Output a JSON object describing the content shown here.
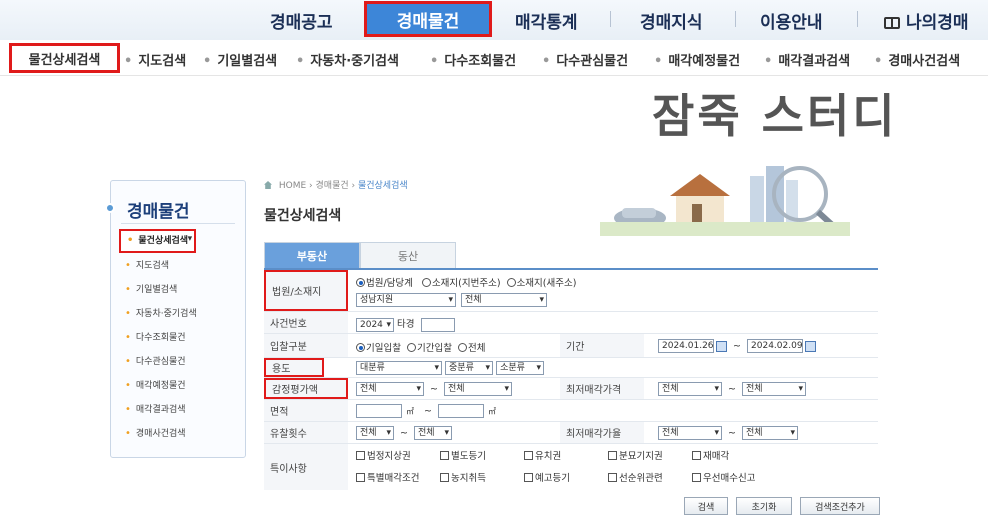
{
  "topnav": {
    "items": [
      "경매공고",
      "경매물건",
      "매각통계",
      "경매지식",
      "이용안내",
      "나의경매"
    ],
    "active": "경매물건"
  },
  "subnav": {
    "items": [
      "물건상세검색",
      "지도검색",
      "기일별검색",
      "자동차·중기검색",
      "다수조회물건",
      "다수관심물건",
      "매각예정물건",
      "매각결과검색",
      "경매사건검색"
    ]
  },
  "overlay_title": "잠죽 스터디",
  "sidebar": {
    "title": "경매물건",
    "items": [
      "물건상세검색",
      "지도검색",
      "기일별검색",
      "자동차·중기검색",
      "다수조회물건",
      "다수관심물건",
      "매각예정물건",
      "매각결과검색",
      "경매사건검색"
    ]
  },
  "breadcrumb": [
    "HOME",
    "경매물건",
    "물건상세검색"
  ],
  "page_title": "물건상세검색",
  "tabs": [
    "부동산",
    "동산"
  ],
  "form": {
    "court": {
      "label": "법원/소재지",
      "radio_options": [
        "법원/담당계",
        "소재지(지번주소)",
        "소재지(새주소)"
      ],
      "court_select": "성남지원",
      "dept_select": "전체"
    },
    "case_no": {
      "label": "사건번호",
      "year": "2024",
      "suffix": "타경"
    },
    "bid_type": {
      "label": "입찰구분",
      "radio_options": [
        "기일입찰",
        "기간입찰",
        "전체"
      ],
      "period_label": "기간",
      "date_from": "2024.01.26",
      "date_to": "2024.02.09"
    },
    "usage": {
      "label": "용도",
      "major": "대분류",
      "middle": "중분류",
      "minor": "소분류"
    },
    "appraisal": {
      "label": "감정평가액",
      "from": "전체",
      "to": "전체",
      "min_price_label": "최저매각가격",
      "min_from": "전체",
      "min_to": "전체"
    },
    "area": {
      "label": "면적",
      "unit": "㎡"
    },
    "fail_count": {
      "label": "유찰횟수",
      "from": "전체",
      "to": "전체",
      "rate_label": "최저매각가율",
      "rate_from": "전체",
      "rate_to": "전체"
    },
    "special": {
      "label": "특이사항",
      "row1": [
        "법정지상권",
        "별도등기",
        "유치권",
        "분묘기지권",
        "재매각"
      ],
      "row2": [
        "특별매각조건",
        "농지취득",
        "예고등기",
        "선순위관련",
        "우선매수신고"
      ]
    }
  },
  "buttons": {
    "search": "검색",
    "reset": "초기화",
    "add_condition": "검색조건추가"
  },
  "colors": {
    "accent_red": "#e01a1a",
    "nav_blue": "#3d86d8",
    "tab_blue": "#6aa0dc"
  }
}
